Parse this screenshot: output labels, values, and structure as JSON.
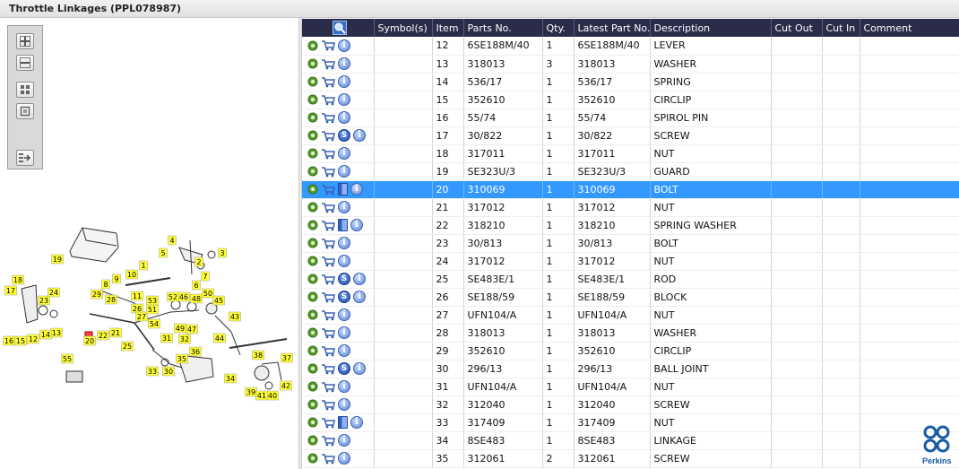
{
  "window": {
    "title": "Throttle Linkages (PPL078987)"
  },
  "zoom_toolbar": {
    "buttons": [
      "zoom-in",
      "zoom-out",
      "fit-page",
      "actual-size",
      "export"
    ]
  },
  "diagram": {
    "callouts": [
      "1",
      "2",
      "3",
      "4",
      "5",
      "6",
      "7",
      "8",
      "9",
      "10",
      "11",
      "12",
      "13",
      "14",
      "15",
      "16",
      "17",
      "18",
      "19",
      "20",
      "21",
      "22",
      "23",
      "24",
      "25",
      "26",
      "27",
      "28",
      "29",
      "30",
      "31",
      "32",
      "33",
      "34",
      "35",
      "36",
      "37",
      "38",
      "39",
      "40",
      "41",
      "42",
      "43",
      "44",
      "45",
      "46",
      "47",
      "48",
      "49",
      "50",
      "51",
      "52",
      "53",
      "54",
      "55"
    ]
  },
  "table": {
    "columns": [
      "",
      "Symbol(s)",
      "Item",
      "Parts No.",
      "Qty.",
      "Latest Part No.",
      "Description",
      "Cut Out",
      "Cut In",
      "Comment"
    ],
    "rows": [
      {
        "icons": [
          "gear",
          "cart",
          "info"
        ],
        "item": "12",
        "part": "6SE188M/40",
        "qty": "1",
        "latest": "6SE188M/40",
        "desc": "LEVER"
      },
      {
        "icons": [
          "gear",
          "cart",
          "info"
        ],
        "item": "13",
        "part": "318013",
        "qty": "3",
        "latest": "318013",
        "desc": "WASHER"
      },
      {
        "icons": [
          "gear",
          "cart",
          "info"
        ],
        "item": "14",
        "part": "536/17",
        "qty": "1",
        "latest": "536/17",
        "desc": "SPRING"
      },
      {
        "icons": [
          "gear",
          "cart",
          "info"
        ],
        "item": "15",
        "part": "352610",
        "qty": "1",
        "latest": "352610",
        "desc": "CIRCLIP"
      },
      {
        "icons": [
          "gear",
          "cart",
          "info"
        ],
        "item": "16",
        "part": "55/74",
        "qty": "1",
        "latest": "55/74",
        "desc": "SPIROL PIN"
      },
      {
        "icons": [
          "gear",
          "cart",
          "s",
          "info"
        ],
        "item": "17",
        "part": "30/822",
        "qty": "1",
        "latest": "30/822",
        "desc": "SCREW"
      },
      {
        "icons": [
          "gear",
          "cart",
          "info"
        ],
        "item": "18",
        "part": "317011",
        "qty": "1",
        "latest": "317011",
        "desc": "NUT"
      },
      {
        "icons": [
          "gear",
          "cart",
          "info"
        ],
        "item": "19",
        "part": "SE323U/3",
        "qty": "1",
        "latest": "SE323U/3",
        "desc": "GUARD"
      },
      {
        "icons": [
          "gear",
          "cart",
          "book",
          "info"
        ],
        "item": "20",
        "part": "310069",
        "qty": "1",
        "latest": "310069",
        "desc": "BOLT",
        "selected": true
      },
      {
        "icons": [
          "gear",
          "cart",
          "info"
        ],
        "item": "21",
        "part": "317012",
        "qty": "1",
        "latest": "317012",
        "desc": "NUT"
      },
      {
        "icons": [
          "gear",
          "cart",
          "book",
          "info"
        ],
        "item": "22",
        "part": "318210",
        "qty": "1",
        "latest": "318210",
        "desc": "SPRING WASHER"
      },
      {
        "icons": [
          "gear",
          "cart",
          "info"
        ],
        "item": "23",
        "part": "30/813",
        "qty": "1",
        "latest": "30/813",
        "desc": "BOLT"
      },
      {
        "icons": [
          "gear",
          "cart",
          "info"
        ],
        "item": "24",
        "part": "317012",
        "qty": "1",
        "latest": "317012",
        "desc": "NUT"
      },
      {
        "icons": [
          "gear",
          "cart",
          "s",
          "info"
        ],
        "item": "25",
        "part": "SE483E/1",
        "qty": "1",
        "latest": "SE483E/1",
        "desc": "ROD"
      },
      {
        "icons": [
          "gear",
          "cart",
          "s",
          "info"
        ],
        "item": "26",
        "part": "SE188/59",
        "qty": "1",
        "latest": "SE188/59",
        "desc": "BLOCK"
      },
      {
        "icons": [
          "gear",
          "cart",
          "info"
        ],
        "item": "27",
        "part": "UFN104/A",
        "qty": "1",
        "latest": "UFN104/A",
        "desc": "NUT"
      },
      {
        "icons": [
          "gear",
          "cart",
          "info"
        ],
        "item": "28",
        "part": "318013",
        "qty": "1",
        "latest": "318013",
        "desc": "WASHER"
      },
      {
        "icons": [
          "gear",
          "cart",
          "info"
        ],
        "item": "29",
        "part": "352610",
        "qty": "1",
        "latest": "352610",
        "desc": "CIRCLIP"
      },
      {
        "icons": [
          "gear",
          "cart",
          "s",
          "info"
        ],
        "item": "30",
        "part": "296/13",
        "qty": "1",
        "latest": "296/13",
        "desc": "BALL JOINT"
      },
      {
        "icons": [
          "gear",
          "cart",
          "info"
        ],
        "item": "31",
        "part": "UFN104/A",
        "qty": "1",
        "latest": "UFN104/A",
        "desc": "NUT"
      },
      {
        "icons": [
          "gear",
          "cart",
          "info"
        ],
        "item": "32",
        "part": "312040",
        "qty": "1",
        "latest": "312040",
        "desc": "SCREW"
      },
      {
        "icons": [
          "gear",
          "cart",
          "book",
          "info"
        ],
        "item": "33",
        "part": "317409",
        "qty": "1",
        "latest": "317409",
        "desc": "NUT"
      },
      {
        "icons": [
          "gear",
          "cart",
          "info"
        ],
        "item": "34",
        "part": "8SE483",
        "qty": "1",
        "latest": "8SE483",
        "desc": "LINKAGE"
      },
      {
        "icons": [
          "gear",
          "cart",
          "info"
        ],
        "item": "35",
        "part": "312061",
        "qty": "2",
        "latest": "312061",
        "desc": "SCREW"
      }
    ]
  },
  "brand": {
    "name": "Perkins",
    "color": "#1a5ba6"
  },
  "colors": {
    "header_bg": "#2b2b4a",
    "selected_row": "#3399ff",
    "callout": "#ffff33"
  }
}
